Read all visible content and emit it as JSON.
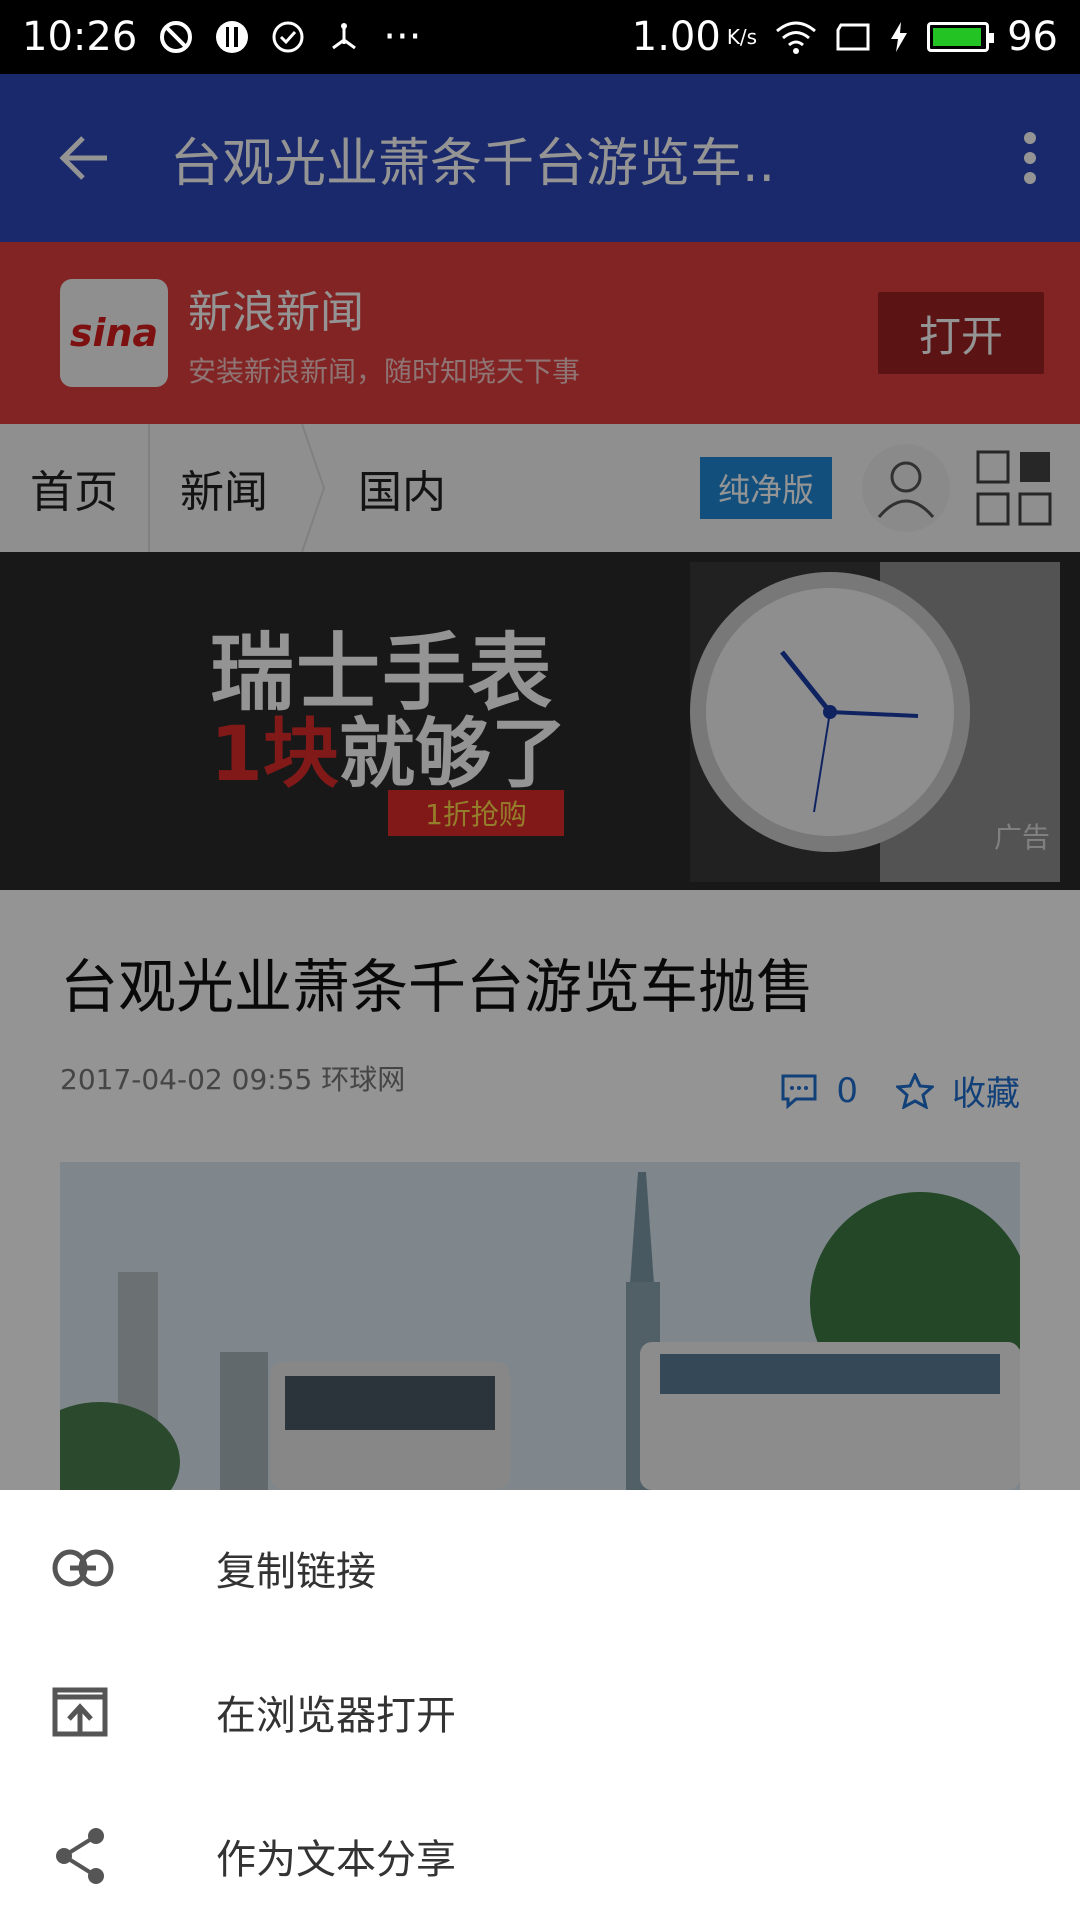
{
  "status_bar": {
    "time": "10:26",
    "ellipsis": "···",
    "network_speed": "1.00",
    "speed_unit": "K/s",
    "battery": "96",
    "battery_fill_fraction": 0.96,
    "battery_color": "#22c322"
  },
  "app_bar": {
    "title": "台观光业萧条千台游览车..",
    "back_icon": "arrow-left-icon",
    "more_icon": "more-vertical-icon",
    "color": "#2e48b9"
  },
  "promo": {
    "logo_text": "sina",
    "app_name": "新浪新闻",
    "description": "安装新浪新闻，随时知晓天下事",
    "open_label": "打开",
    "color": "#e23e3e"
  },
  "breadcrumb": {
    "items": [
      "首页",
      "新闻",
      "国内"
    ],
    "clean_label": "纯净版",
    "avatar_icon": "user-icon",
    "grid_icon": "grid-icon"
  },
  "ad": {
    "line1": "瑞士手表",
    "line2_red": "1块",
    "line2_white": "就够了",
    "button": "1折抢购",
    "tag": "广告"
  },
  "article": {
    "headline": "台观光业萧条千台游览车抛售",
    "meta": "2017-04-02 09:55 环球网",
    "comment_count": "0",
    "favorite_label": "收藏",
    "accent": "#1f6fd0"
  },
  "sheet": {
    "items": [
      {
        "label": "复制链接",
        "icon": "link-icon"
      },
      {
        "label": "在浏览器打开",
        "icon": "open-in-browser-icon"
      },
      {
        "label": "作为文本分享",
        "icon": "share-icon"
      }
    ]
  }
}
